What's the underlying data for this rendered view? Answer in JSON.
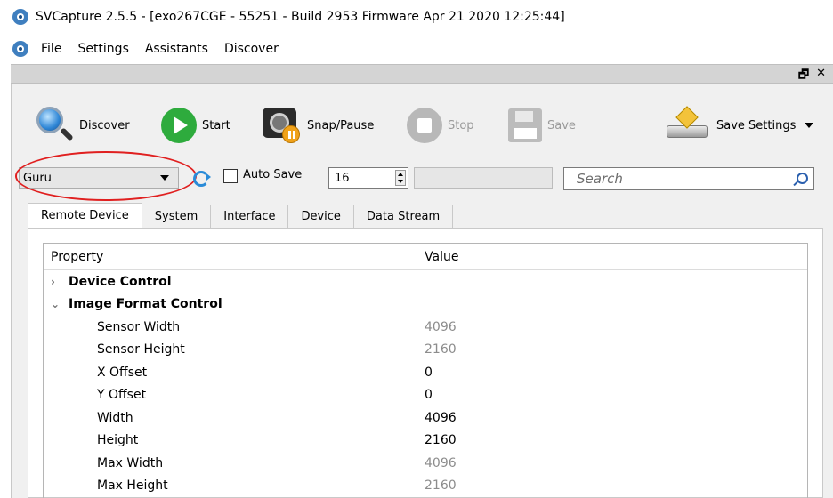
{
  "window": {
    "title": "SVCapture 2.5.5 - [exo267CGE - 55251 - Build 2953 Firmware Apr 21 2020 12:25:44]"
  },
  "menu": [
    "File",
    "Settings",
    "Assistants",
    "Discover"
  ],
  "mdi_controls": {
    "restore": "🗗",
    "close": "✕"
  },
  "toolbar": {
    "discover": "Discover",
    "start": "Start",
    "snap_pause": "Snap/Pause",
    "stop": "Stop",
    "save": "Save",
    "save_settings": "Save Settings"
  },
  "controls": {
    "visibility": "Guru",
    "auto_save_label": "Auto Save",
    "auto_save_checked": false,
    "count_value": "16",
    "search_placeholder": "Search"
  },
  "tabs": [
    "Remote Device",
    "System",
    "Interface",
    "Device",
    "Data Stream"
  ],
  "active_tab": "Remote Device",
  "grid": {
    "header_property": "Property",
    "header_value": "Value",
    "groups": [
      {
        "label": "Device Control",
        "expanded": false,
        "chevron": "›"
      },
      {
        "label": "Image Format Control",
        "expanded": true,
        "chevron": "⌄"
      }
    ],
    "rows": [
      {
        "property": "Sensor Width",
        "value": "4096",
        "readonly": true
      },
      {
        "property": "Sensor Height",
        "value": "2160",
        "readonly": true
      },
      {
        "property": "X Offset",
        "value": "0",
        "readonly": false
      },
      {
        "property": "Y Offset",
        "value": "0",
        "readonly": false
      },
      {
        "property": "Width",
        "value": "4096",
        "readonly": false
      },
      {
        "property": "Height",
        "value": "2160",
        "readonly": false
      },
      {
        "property": "Max Width",
        "value": "4096",
        "readonly": true
      },
      {
        "property": "Max Height",
        "value": "2160",
        "readonly": true
      }
    ]
  },
  "colors": {
    "accent": "#2a8bd8",
    "highlight_ring": "#e02020",
    "start_green": "#2eab3d"
  }
}
